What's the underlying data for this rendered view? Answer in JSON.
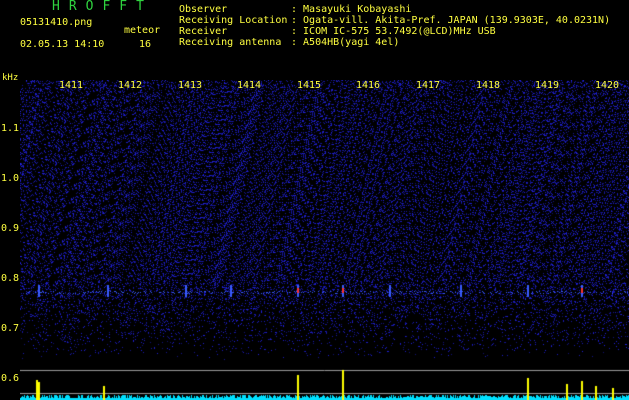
{
  "header": {
    "title": "HROFFT",
    "filename": "05131410.png",
    "datetime": "02.05.13 14:10",
    "meteor_label": "meteor",
    "meteor_count": "16"
  },
  "station": [
    {
      "key": "Observer",
      "value": ": Masayuki Kobayashi"
    },
    {
      "key": "Receiving Location",
      "value": ": Ogata-vill. Akita-Pref. JAPAN (139.9303E, 40.0231N)"
    },
    {
      "key": "Receiver",
      "value": ": ICOM IC-575 53.7492(@LCD)MHz USB"
    },
    {
      "key": "Receiving antenna",
      "value": ": A504HB(yagi 4el)"
    }
  ],
  "waterfall": {
    "y_unit": "kHz",
    "x_ticks": [
      "1411",
      "1412",
      "1413",
      "1414",
      "1415",
      "1416",
      "1417",
      "1418",
      "1419",
      "1420"
    ],
    "y_ticks": [
      "1.1",
      "1.0",
      "0.9",
      "0.8",
      "0.7",
      "0.6"
    ],
    "colors": {
      "background": "#000000",
      "noise": "#2020c8",
      "trace": "#3a5cff",
      "echo": "#ff3030",
      "label": "#ffff40",
      "title": "#2fd33f",
      "spectrum": "#ffff00",
      "baseline": "#00e0ff"
    }
  }
}
